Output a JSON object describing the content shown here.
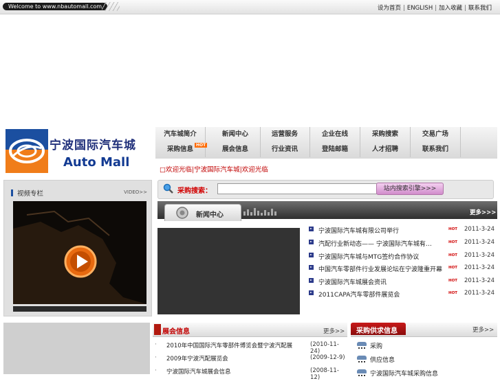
{
  "topbar": {
    "welcome": "Welcome to www.nbautomall.com",
    "links": [
      "设为首页",
      "ENGLISH",
      "加入收藏",
      "联系我们"
    ],
    "separator": "|"
  },
  "logo": {
    "name_cn": "宁波国际汽车城",
    "name_en": "Auto Mall"
  },
  "nav": {
    "row1": [
      "汽车城简介",
      "新闻中心",
      "运营服务",
      "企业在线",
      "采购搜索",
      "交易广场"
    ],
    "row2": [
      "采购信息",
      "展会信息",
      "行业资讯",
      "登陆邮箱",
      "人才招聘",
      "联系我们"
    ],
    "hot_badge": "HOT"
  },
  "notice": "□欢迎光临|宁波国际汽车城|欢迎光临",
  "video": {
    "title": "视频专栏",
    "more": "VIDEO>>"
  },
  "search": {
    "label": "采购搜索：",
    "input_value": "",
    "button": "站内搜索引擎>>>"
  },
  "news": {
    "title": "新闻中心",
    "more": "更多>>>",
    "items": [
      {
        "text": "宁波国际汽车城有限公司举行",
        "hot": "HOT",
        "date": "2011-3-24"
      },
      {
        "text": "汽配行业新动态—— 宁波国际汽车城有…",
        "hot": "HOT",
        "date": "2011-3-24"
      },
      {
        "text": "宁波国际汽车城与MTG签约合作协议",
        "hot": "HOT",
        "date": "2011-3-24"
      },
      {
        "text": "中国汽车零部件行业发展论坛在宁波隆重开幕",
        "hot": "HOT",
        "date": "2011-3-24"
      },
      {
        "text": "宁波国际汽车城展会资讯",
        "hot": "HOT",
        "date": "2011-3-24"
      },
      {
        "text": "2011CAPA汽车零部件展览会",
        "hot": "HOT",
        "date": "2011-3-24"
      }
    ]
  },
  "expo": {
    "title": "展会信息",
    "more": "更多>>",
    "items": [
      {
        "bullet": "·",
        "text": "2010年中国国际汽车零部件博览会暨宁波汽配展",
        "date": "(2010-11-24)"
      },
      {
        "bullet": "·",
        "text": "2009年宁波汽配展览会",
        "date": "(2009-12-9)"
      },
      {
        "bullet": "·",
        "text": "宁波国际汽车城展会信息",
        "date": "(2008-11-12)"
      }
    ]
  },
  "supply": {
    "title": "采购供求信息",
    "more": "更多>>",
    "items": [
      "采购",
      "供应信息",
      "宁波国际汽车城采购信息"
    ]
  }
}
